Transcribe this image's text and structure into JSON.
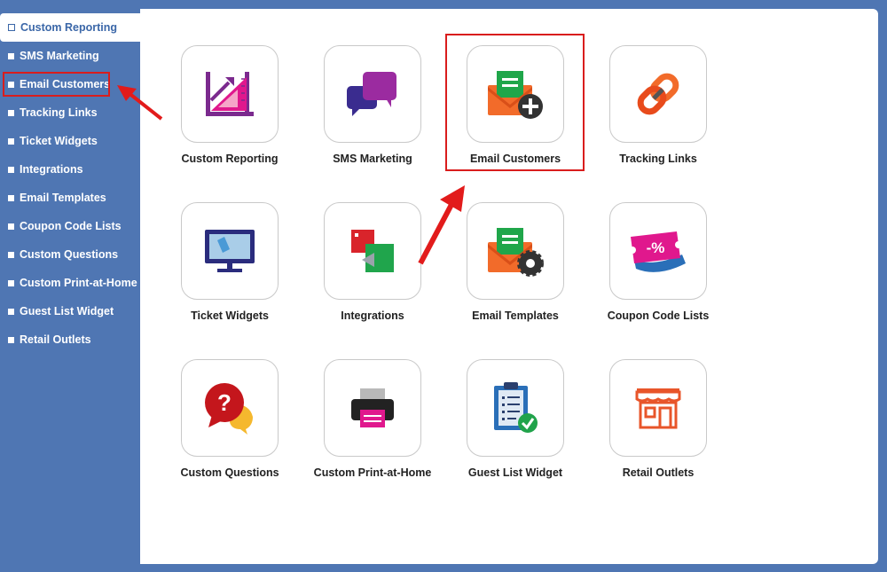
{
  "sidebar": {
    "items": [
      {
        "label": "Custom Reporting"
      },
      {
        "label": "SMS Marketing"
      },
      {
        "label": "Email Customers"
      },
      {
        "label": "Tracking Links"
      },
      {
        "label": "Ticket Widgets"
      },
      {
        "label": "Integrations"
      },
      {
        "label": "Email Templates"
      },
      {
        "label": "Coupon Code Lists"
      },
      {
        "label": "Custom Questions"
      },
      {
        "label": "Custom Print-at-Home"
      },
      {
        "label": "Guest List Widget"
      },
      {
        "label": "Retail Outlets"
      }
    ]
  },
  "tiles": [
    {
      "label": "Custom Reporting",
      "icon": "chart-growth-icon"
    },
    {
      "label": "SMS Marketing",
      "icon": "chat-bubbles-icon"
    },
    {
      "label": "Email Customers",
      "icon": "envelope-add-icon"
    },
    {
      "label": "Tracking Links",
      "icon": "chain-link-icon"
    },
    {
      "label": "Ticket Widgets",
      "icon": "monitor-ticket-icon"
    },
    {
      "label": "Integrations",
      "icon": "integration-squares-icon"
    },
    {
      "label": "Email Templates",
      "icon": "envelope-gear-icon"
    },
    {
      "label": "Coupon Code Lists",
      "icon": "coupon-percent-icon"
    },
    {
      "label": "Custom Questions",
      "icon": "question-bubble-icon"
    },
    {
      "label": "Custom Print-at-Home",
      "icon": "printer-icon"
    },
    {
      "label": "Guest List Widget",
      "icon": "clipboard-check-icon"
    },
    {
      "label": "Retail Outlets",
      "icon": "storefront-icon"
    }
  ],
  "coupon_text": "-%",
  "colors": {
    "sidebar_bg": "#4f76b3",
    "highlight_red": "#d91d1d",
    "active_text": "#3b67a8"
  }
}
